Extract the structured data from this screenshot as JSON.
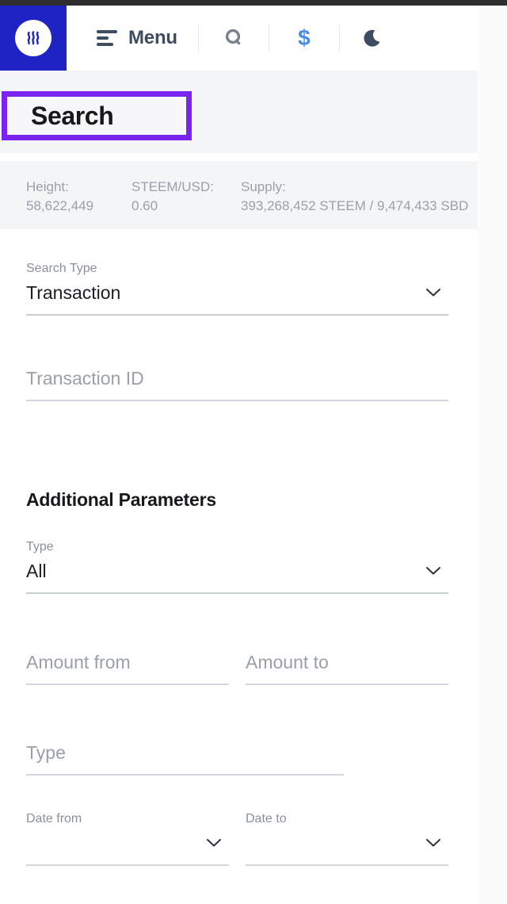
{
  "header": {
    "logo_name": "steem-logo",
    "menu_label": "Menu",
    "search_icon": "search-icon",
    "price_icon": "dollar-icon",
    "theme_icon": "moon-icon",
    "price_icon_color": "#4a8ce8"
  },
  "page": {
    "title": "Search",
    "highlight_color": "#7b23ef",
    "brand_color": "#1f23c4"
  },
  "stats": [
    {
      "key": "Height:",
      "value": "58,622,449"
    },
    {
      "key": "STEEM/USD:",
      "value": "0.60"
    },
    {
      "key": "Supply:",
      "value": "393,268,452 STEEM / 9,474,433 SBD"
    }
  ],
  "form": {
    "search_type": {
      "label": "Search Type",
      "value": "Transaction"
    },
    "transaction_id": {
      "placeholder": "Transaction ID",
      "value": ""
    },
    "additional_heading": "Additional Parameters",
    "type_select": {
      "label": "Type",
      "value": "All"
    },
    "amount_from": {
      "placeholder": "Amount from",
      "value": ""
    },
    "amount_to": {
      "placeholder": "Amount to",
      "value": ""
    },
    "type_text": {
      "placeholder": "Type",
      "value": ""
    },
    "date_from": {
      "label": "Date from",
      "value": ""
    },
    "date_to": {
      "label": "Date to",
      "value": ""
    }
  }
}
